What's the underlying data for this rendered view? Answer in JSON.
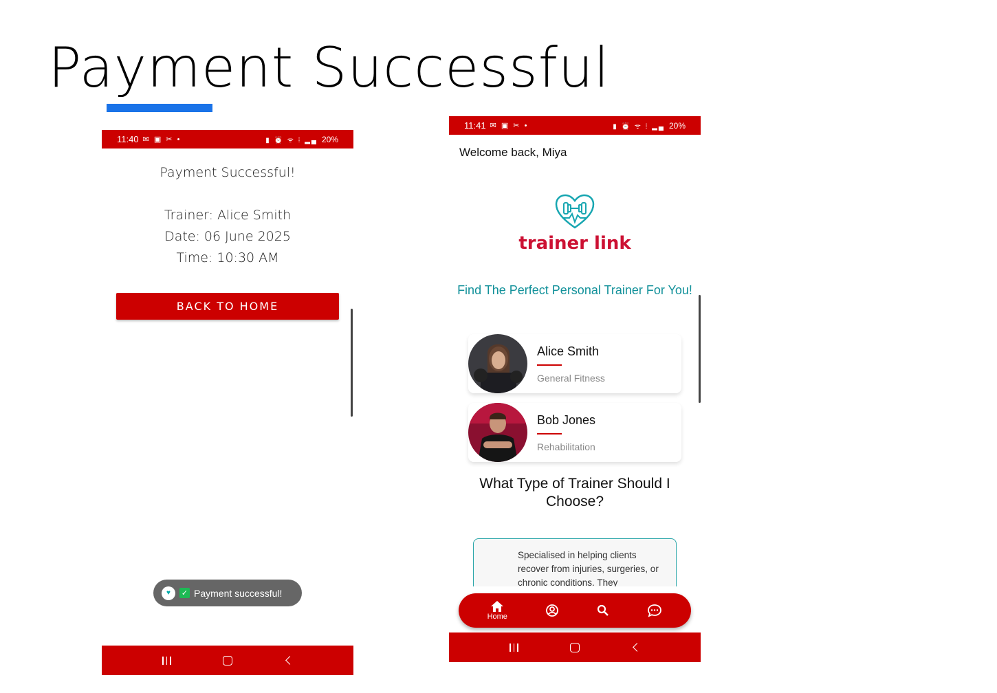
{
  "slide": {
    "title": "Payment Successful",
    "accent_color": "#1a73e8"
  },
  "colors": {
    "brand_red": "#cc0000",
    "teal": "#12919a"
  },
  "left_phone": {
    "status_bar": {
      "time": "11:40",
      "glyphs": "✉ ▣ ✂ •",
      "right_icons": "▮ ⏰ ᯤ ⁞ ▂▄",
      "battery": "20%"
    },
    "confirmation": {
      "heading": "Payment Successful!",
      "trainer": "Trainer: Alice Smith",
      "date": "Date: 06 June 2025",
      "time": "Time: 10:30 AM"
    },
    "back_home_label": "BACK TO HOME",
    "toast": {
      "message": "Payment successful!"
    }
  },
  "right_phone": {
    "status_bar": {
      "time": "11:41",
      "glyphs": "✉ ▣ ✂ •",
      "right_icons": "▮ ⏰ ᯤ ⁞ ▂▄",
      "battery": "20%"
    },
    "welcome": "Welcome back, Miya",
    "logo_text": "trainer link",
    "find_heading": "Find The Perfect Personal Trainer For You!",
    "trainers": [
      {
        "name": "Alice Smith",
        "specialty": "General Fitness"
      },
      {
        "name": "Bob Jones",
        "specialty": "Rehabilitation"
      }
    ],
    "which_heading": "What Type of Trainer Should I Choose?",
    "info_text": "Specialised in helping clients recover from injuries, surgeries, or chronic conditions. They",
    "tabs": [
      {
        "label": "Home",
        "icon": "home-icon"
      },
      {
        "label": "",
        "icon": "profile-icon"
      },
      {
        "label": "",
        "icon": "search-icon"
      },
      {
        "label": "",
        "icon": "chat-icon"
      }
    ]
  }
}
